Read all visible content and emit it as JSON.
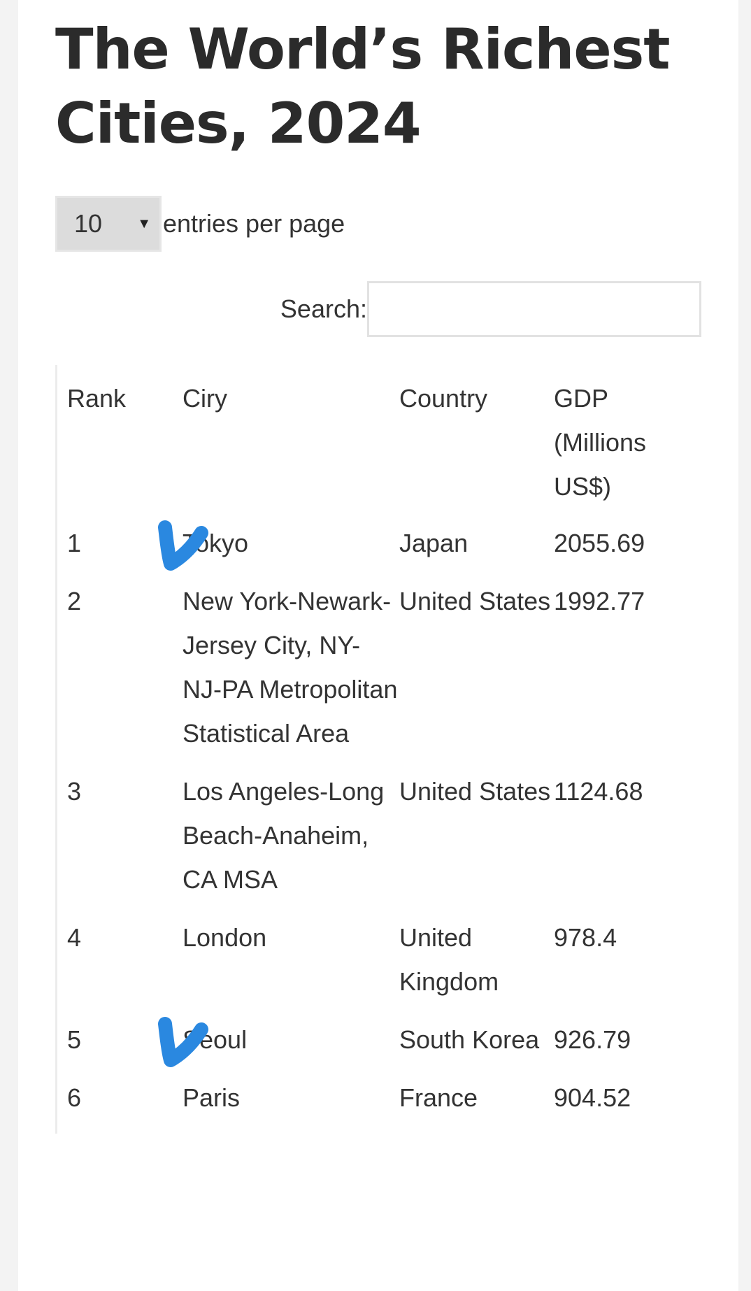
{
  "page": {
    "title": "The World’s Richest Cities, 2024"
  },
  "controls": {
    "entries_value": "10",
    "entries_label": "entries per page",
    "search_label": "Search:",
    "search_value": "",
    "search_placeholder": ""
  },
  "table": {
    "headers": {
      "rank": "Rank",
      "city": "Ciry",
      "country": "Country",
      "gdp": "GDP (Millions US$)"
    },
    "rows": [
      {
        "rank": "1",
        "city": "Tokyo",
        "country": "Japan",
        "gdp": "2055.69",
        "checked": true
      },
      {
        "rank": "2",
        "city": "New York-Newark-Jersey City, NY-NJ-PA Metropolitan Statistical Area",
        "country": "United States",
        "gdp": "1992.77",
        "checked": false
      },
      {
        "rank": "3",
        "city": "Los Angeles-Long Beach-Anaheim, CA MSA",
        "country": "United States",
        "gdp": "1124.68",
        "checked": false
      },
      {
        "rank": "4",
        "city": "London",
        "country": "United Kingdom",
        "gdp": "978.4",
        "checked": false
      },
      {
        "rank": "5",
        "city": "Seoul",
        "country": "South Korea",
        "gdp": "926.79",
        "checked": true
      },
      {
        "rank": "6",
        "city": "Paris",
        "country": "France",
        "gdp": "904.52",
        "checked": false
      }
    ]
  },
  "colors": {
    "check_mark": "#2a88e0",
    "select_bg": "#dcdcdc",
    "text": "#333333"
  },
  "icons": {
    "row_marker": "check-mark-icon",
    "entries_caret": "caret-down-icon"
  }
}
